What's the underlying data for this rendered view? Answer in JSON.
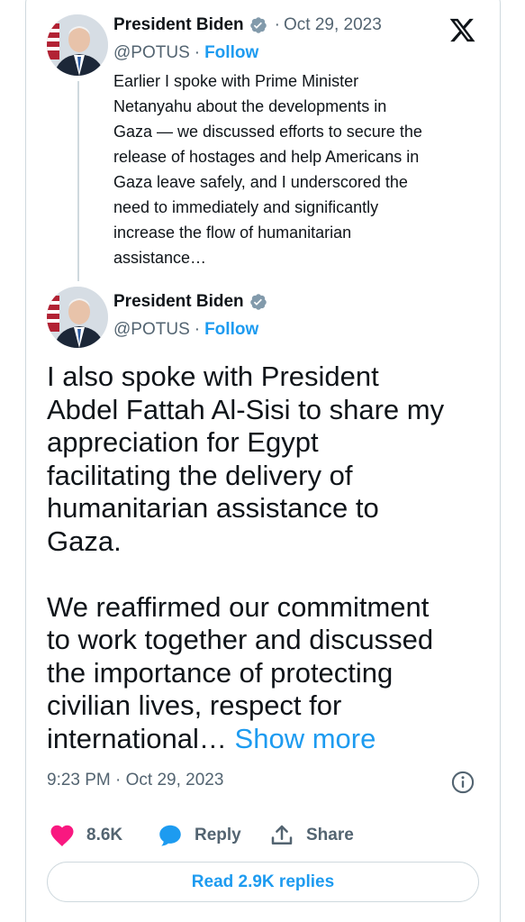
{
  "quoted_tweet": {
    "display_name": "President Biden",
    "handle": "@POTUS",
    "follow_label": "Follow",
    "date": "Oct 29, 2023",
    "lines": [
      "Earlier I spoke with Prime Minister",
      "Netanyahu about the developments in",
      "Gaza — we discussed efforts to secure the",
      "release of hostages and help Americans in",
      "Gaza leave safely, and I underscored the",
      "need to immediately and significantly",
      "increase the flow of humanitarian",
      "assistance…"
    ]
  },
  "main_tweet": {
    "display_name": "President Biden",
    "handle": "@POTUS",
    "follow_label": "Follow",
    "paragraph1_lines": [
      "I also spoke with President",
      "Abdel Fattah Al-Sisi to share my",
      "appreciation for Egypt",
      "facilitating the delivery of",
      "humanitarian assistance to",
      "Gaza."
    ],
    "paragraph2_lines": [
      "We reaffirmed our commitment",
      "to work together and discussed",
      "the importance of protecting",
      "civilian lives, respect for"
    ],
    "last_line": "international…",
    "show_more_label": "Show more",
    "timestamp": "9:23 PM · Oct 29, 2023"
  },
  "actions": {
    "like_count": "8.6K",
    "reply_label": "Reply",
    "share_label": "Share"
  },
  "read_replies_label": "Read 2.9K replies",
  "separators": {
    "dot": "·"
  },
  "icons": {
    "verified": "verified-badge-icon",
    "x_logo": "x-logo-icon",
    "info": "info-icon",
    "like": "heart-icon",
    "reply": "speech-bubble-icon",
    "share": "share-upload-icon"
  },
  "colors": {
    "accent": "#1d9bf0",
    "like": "#f91880",
    "text_primary": "#0f1419",
    "text_secondary": "#536471",
    "border": "#cfd9de"
  }
}
